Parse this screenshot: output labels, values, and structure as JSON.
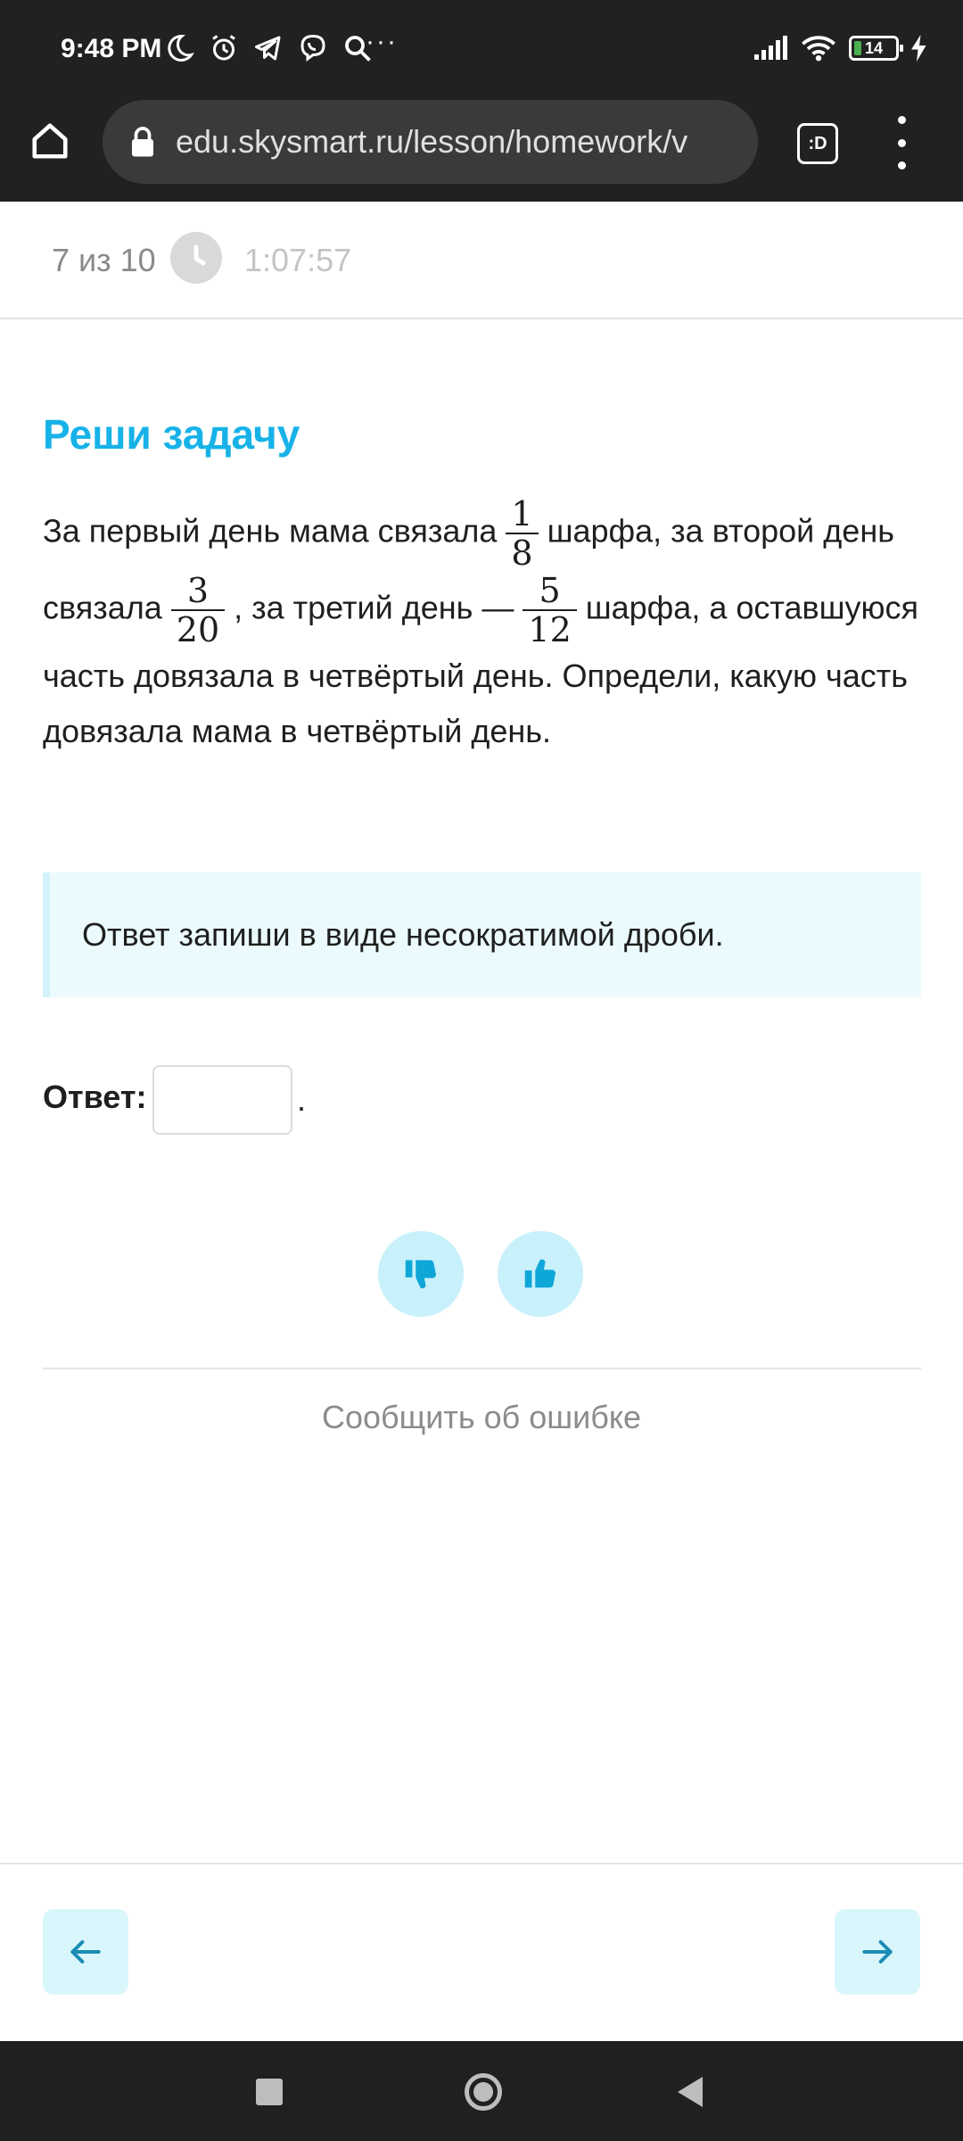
{
  "status_bar": {
    "time": "9:48 PM",
    "dots": "···",
    "battery": "14",
    "icons": [
      "moon-icon",
      "alarm-icon",
      "telegram-icon",
      "viber-icon",
      "search-icon",
      "signal-icon",
      "wifi-icon",
      "battery-icon",
      "charging-icon"
    ]
  },
  "browser": {
    "url": "edu.skysmart.ru/lesson/homework/v",
    "tab_label": ":D",
    "icons": [
      "home-icon",
      "lock-icon",
      "tabs-icon",
      "more-vert-icon"
    ]
  },
  "progress": {
    "counter": "7 из 10",
    "timer": "1:07:57"
  },
  "task": {
    "title": "Реши задачу",
    "text_parts": {
      "p1": "За первый день мама связала",
      "p2": "шарфа, за второй день связала",
      "p3": ", за третий день —",
      "p4": "шарфа, а оставшуюся часть довязала в четвёртый день. Определи, какую часть довязала мама в четвёртый день."
    },
    "fractions": [
      {
        "num": "1",
        "den": "8"
      },
      {
        "num": "3",
        "den": "20"
      },
      {
        "num": "5",
        "den": "12"
      }
    ],
    "hint": "Ответ запиши в виде несократимой дроби.",
    "answer_label": "Ответ:",
    "answer_value": "",
    "answer_suffix": "."
  },
  "feedback": {
    "report_link": "Сообщить об ошибке"
  },
  "colors": {
    "accent": "#17b2e8",
    "hint_bg": "#ebfafd",
    "rate_bg": "#c8f1fb",
    "nav_bg": "#d9f6fc",
    "nav_icon": "#1a8cb5"
  }
}
